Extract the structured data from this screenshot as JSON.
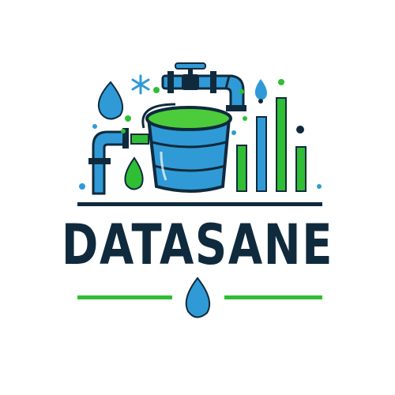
{
  "brand": {
    "name": "DATASANE"
  },
  "colors": {
    "navy": "#0f2a3d",
    "blue": "#2f9ad6",
    "light_blue": "#56b8ea",
    "green": "#2fbe34",
    "bucket_green": "#4ccc3a",
    "background": "#ffffff"
  },
  "icons": [
    "water-drop-icon",
    "pipe-icon",
    "valve-icon",
    "bucket-icon",
    "bar-chart-icon",
    "snowflake-icon"
  ]
}
